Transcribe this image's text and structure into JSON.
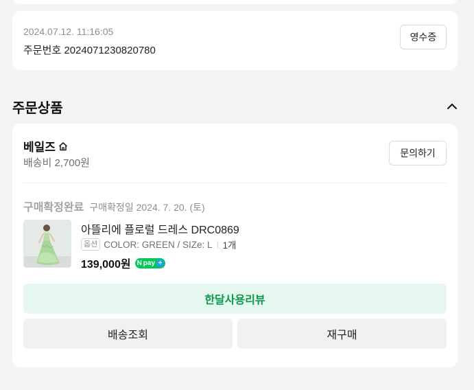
{
  "order": {
    "datetime": "2024.07.12. 11:16:05",
    "number_label": "주문번호",
    "number": "2024071230820780",
    "receipt_button": "영수증"
  },
  "section": {
    "title": "주문상품",
    "collapse_icon": "chevron-up-icon"
  },
  "seller": {
    "name": "베일즈",
    "home_icon": "home-icon",
    "shipping_fee": "배송비 2,700원",
    "inquiry_button": "문의하기"
  },
  "item": {
    "status": "구매확정완료",
    "status_date": "구매확정일 2024. 7. 20. (토)",
    "name": "아뜰리에 플로럴 드레스 DRC0869",
    "option_tag": "옵션",
    "option_value": "COLOR: GREEN / SIZe: L",
    "quantity": "1개",
    "price": "139,000원",
    "npay_label": "pay",
    "npay_n": "N",
    "npay_plus": "+"
  },
  "actions": {
    "review": "한달사용리뷰",
    "track": "배송조회",
    "rebuy": "재구매"
  },
  "colors": {
    "accent_green": "#0a9a4a",
    "review_bg": "#e5f7ee",
    "npay_green": "#03c75a"
  }
}
